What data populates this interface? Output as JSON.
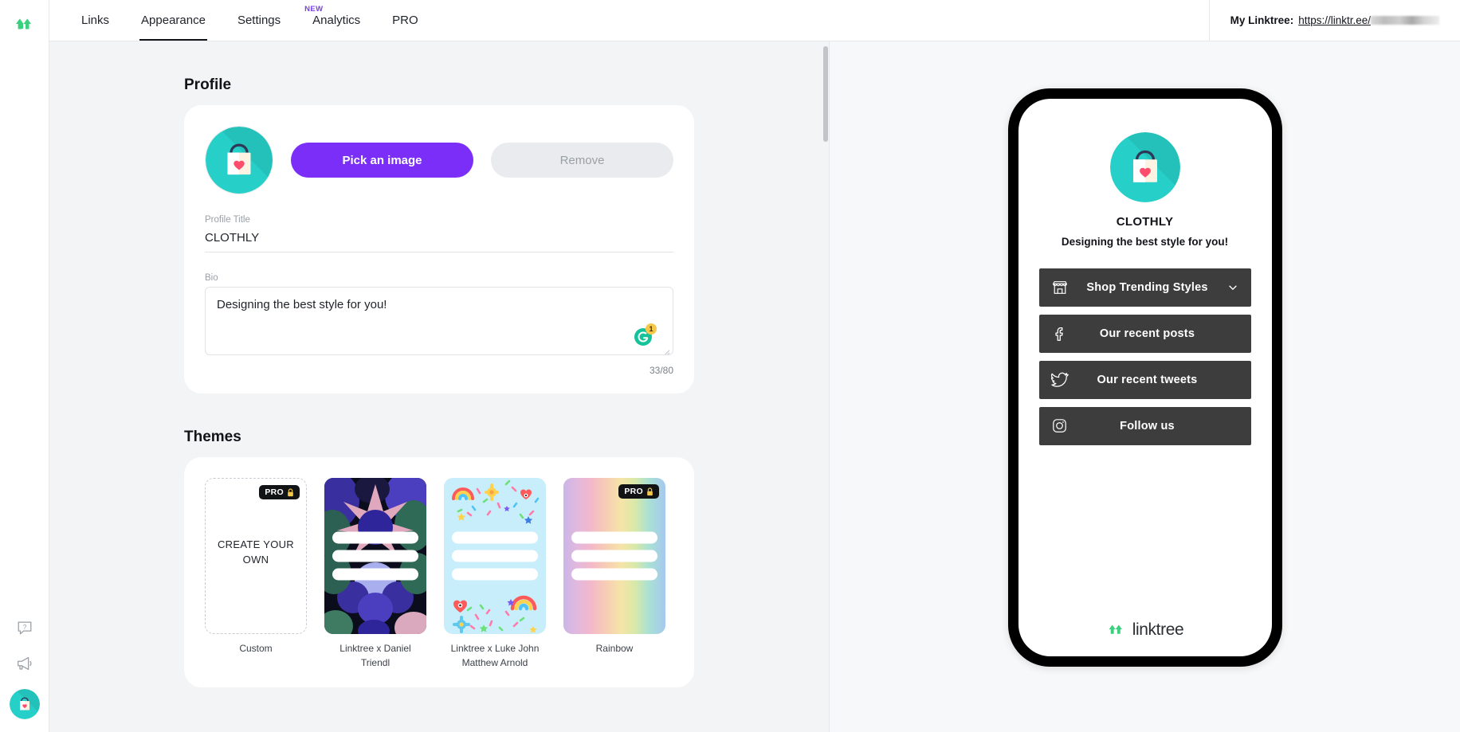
{
  "brand": {
    "name": "linktree",
    "logo_icon": "linktree-logo-icon",
    "accent": "#3bd07f"
  },
  "topbar": {
    "nav": [
      {
        "label": "Links",
        "active": false,
        "badge": null
      },
      {
        "label": "Appearance",
        "active": true,
        "badge": null
      },
      {
        "label": "Settings",
        "active": false,
        "badge": null
      },
      {
        "label": "Analytics",
        "active": false,
        "badge": "NEW"
      },
      {
        "label": "PRO",
        "active": false,
        "badge": null
      }
    ],
    "my_linktree_label": "My Linktree:",
    "my_linktree_url": "https://linktr.ee/",
    "my_linktree_username_redacted": true
  },
  "rail": {
    "help_icon": "help-bubble-icon",
    "announcements_icon": "megaphone-icon",
    "avatar_icon": "shopping-bag-heart-avatar"
  },
  "profile": {
    "section_title": "Profile",
    "avatar_icon": "shopping-bag-heart-avatar",
    "pick_image_label": "Pick an image",
    "remove_label": "Remove",
    "title_field_label": "Profile Title",
    "title_value": "CLOTHLY",
    "title_placeholder": "Profile Title",
    "bio_field_label": "Bio",
    "bio_value": "Designing the best style for you!",
    "bio_placeholder": "Bio",
    "bio_counter": "33/80",
    "grammarly_icon": "grammarly-icon",
    "grammarly_badge": "1"
  },
  "themes": {
    "section_title": "Themes",
    "pro_label": "PRO",
    "lock_icon": "lock-icon",
    "items": [
      {
        "name": "Custom",
        "type": "custom",
        "cta": "CREATE YOUR OWN",
        "pro": true
      },
      {
        "name": "Linktree x Daniel Triendl",
        "type": "artwork-floral",
        "pro": false
      },
      {
        "name": "Linktree x Luke John Matthew Arnold",
        "type": "artwork-confetti",
        "pro": false
      },
      {
        "name": "Rainbow",
        "type": "gradient-rainbow",
        "pro": true
      }
    ]
  },
  "preview": {
    "avatar_icon": "shopping-bag-heart-avatar",
    "title": "CLOTHLY",
    "bio": "Designing the best style for you!",
    "links": [
      {
        "label": "Shop Trending Styles",
        "icon": "storefront-icon",
        "expandable": true
      },
      {
        "label": "Our recent posts",
        "icon": "facebook-icon",
        "expandable": false
      },
      {
        "label": "Our recent tweets",
        "icon": "twitter-icon",
        "expandable": false
      },
      {
        "label": "Follow us",
        "icon": "instagram-icon",
        "expandable": false
      }
    ],
    "footer_wordmark": "linktree",
    "link_bg": "#3d3d3d"
  }
}
